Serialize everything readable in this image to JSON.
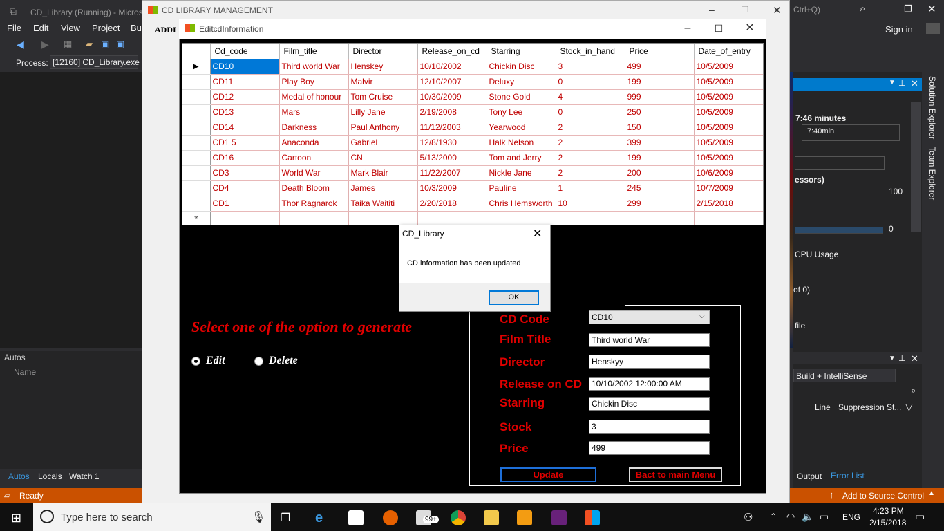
{
  "vs": {
    "title": "CD_Library (Running) - Micros",
    "search_hint": "Ctrl+Q)",
    "sign_in": "Sign in",
    "menu": [
      "File",
      "Edit",
      "View",
      "Project",
      "Bu"
    ],
    "process_label": "Process:",
    "process_value": "[12160] CD_Library.exe",
    "autos_title": "Autos",
    "autos_col_name": "Name",
    "bottom_tabs": [
      "Autos",
      "Locals",
      "Watch 1"
    ],
    "status_ready": "Ready",
    "add_source_control": "Add to Source Control",
    "diag": {
      "duration": "7:46 minutes",
      "tick": "7:40min",
      "processors": "essors)",
      "y_max": "100",
      "y_min": "0",
      "cpu_usage": "CPU Usage",
      "of_zero": "of 0)",
      "profile": "file"
    },
    "error_panel": {
      "filter": "Build + IntelliSense",
      "col_line": "Line",
      "col_supp": "Suppression St...",
      "tabs": [
        "Output",
        "Error List"
      ]
    },
    "side_tabs": [
      "Solution Explorer",
      "Team Explorer"
    ]
  },
  "main_window": {
    "title": "CD LIBRARY MANAGEMENT",
    "menu_partial": "ADDI"
  },
  "edit_window": {
    "title": "EditcdInformation"
  },
  "grid": {
    "columns": [
      "Cd_code",
      "Film_title",
      "Director",
      "Release_on_cd",
      "Starring",
      "Stock_in_hand",
      "Price",
      "Date_of_entry"
    ],
    "rows": [
      [
        "CD10",
        "Third world War",
        "Henskey",
        "10/10/2002",
        "Chickin Disc",
        "3",
        "499",
        "10/5/2009"
      ],
      [
        "CD11",
        "Play Boy",
        "Malvir",
        "12/10/2007",
        "Deluxy",
        "0",
        "199",
        "10/5/2009"
      ],
      [
        "CD12",
        "Medal of honour",
        "Tom Cruise",
        "10/30/2009",
        "Stone Gold",
        "4",
        "999",
        "10/5/2009"
      ],
      [
        "CD13",
        "Mars",
        "Lilly Jane",
        "2/19/2008",
        "Tony Lee",
        "0",
        "250",
        "10/5/2009"
      ],
      [
        "CD14",
        "Darkness",
        "Paul Anthony",
        "11/12/2003",
        "Yearwood",
        "2",
        "150",
        "10/5/2009"
      ],
      [
        "CD1 5",
        "Anaconda",
        "Gabriel",
        "12/8/1930",
        "Halk Nelson",
        "2",
        "399",
        "10/5/2009"
      ],
      [
        "CD16",
        "Cartoon",
        "CN",
        "5/13/2000",
        "Tom and Jerry",
        "2",
        "199",
        "10/5/2009"
      ],
      [
        "CD3",
        "World War",
        "Mark Blair",
        "11/22/2007",
        "Nickle Jane",
        "2",
        "200",
        "10/6/2009"
      ],
      [
        "CD4",
        "Death Bloom",
        "James",
        "10/3/2009",
        "Pauline",
        "1",
        "245",
        "10/7/2009"
      ],
      [
        "CD1",
        "Thor Ragnarok",
        "Taika Waititi",
        "2/20/2018",
        "Chris Hemsworth",
        "10",
        "299",
        "2/15/2018"
      ]
    ],
    "current_row_marker": "▶",
    "new_row_marker": "*"
  },
  "options": {
    "heading": "Select one of the option to generate",
    "edit_label": "Edit",
    "delete_label": "Delete"
  },
  "form": {
    "cd_code_label": "CD Code",
    "cd_code_value": "CD10",
    "film_title_label": "Film Title",
    "film_title_value": "Third world War",
    "director_label": "Director",
    "director_value": "Henskyy",
    "release_label": "Release on CD",
    "release_value": "10/10/2002 12:00:00 AM",
    "starring_label": "Starring",
    "starring_value": "Chickin Disc",
    "stock_label": "Stock",
    "stock_value": "3",
    "price_label": "Price",
    "price_value": "499",
    "update_label": "Update",
    "back_label": "Bact to main Menu"
  },
  "msgbox": {
    "title": "CD_Library",
    "message": "CD information has been updated",
    "ok_label": "OK"
  },
  "taskbar": {
    "search_placeholder": "Type here to search",
    "badge": "99+",
    "lang": "ENG",
    "time": "4:23 PM",
    "date": "2/15/2018"
  },
  "colors": {
    "accent_red": "#e00000",
    "grid_text_red": "#c00000",
    "vs_status_orange": "#ca5100",
    "vs_blue": "#007acc"
  }
}
